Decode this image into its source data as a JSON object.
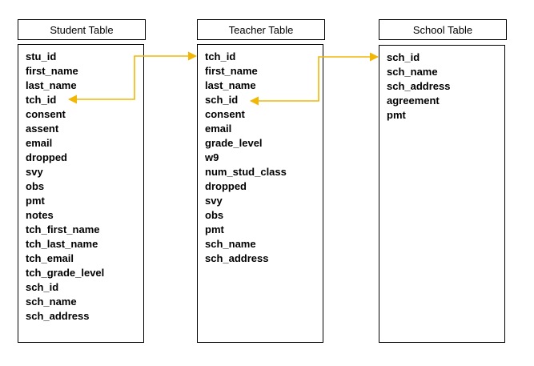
{
  "tables": [
    {
      "key": "student",
      "title": "Student Table",
      "fields": [
        "stu_id",
        "first_name",
        "last_name",
        "tch_id",
        "consent",
        "assent",
        "email",
        "dropped",
        "svy",
        "obs",
        "pmt",
        "notes",
        "tch_first_name",
        "tch_last_name",
        "tch_email",
        "tch_grade_level",
        "sch_id",
        "sch_name",
        "sch_address"
      ]
    },
    {
      "key": "teacher",
      "title": "Teacher Table",
      "fields": [
        "tch_id",
        "first_name",
        "last_name",
        "sch_id",
        "consent",
        "email",
        "grade_level",
        "w9",
        "num_stud_class",
        "dropped",
        "svy",
        "obs",
        "pmt",
        "sch_name",
        "sch_address"
      ]
    },
    {
      "key": "school",
      "title": "School Table",
      "fields": [
        "sch_id",
        "sch_name",
        "sch_address",
        "agreement",
        "pmt"
      ]
    }
  ],
  "relationships": [
    {
      "from_table": "teacher",
      "from_field": "tch_id",
      "to_table": "student",
      "to_field": "tch_id"
    },
    {
      "from_table": "school",
      "from_field": "sch_id",
      "to_table": "teacher",
      "to_field": "sch_id"
    }
  ],
  "colors": {
    "connector": "#f2b705",
    "border": "#000000"
  }
}
